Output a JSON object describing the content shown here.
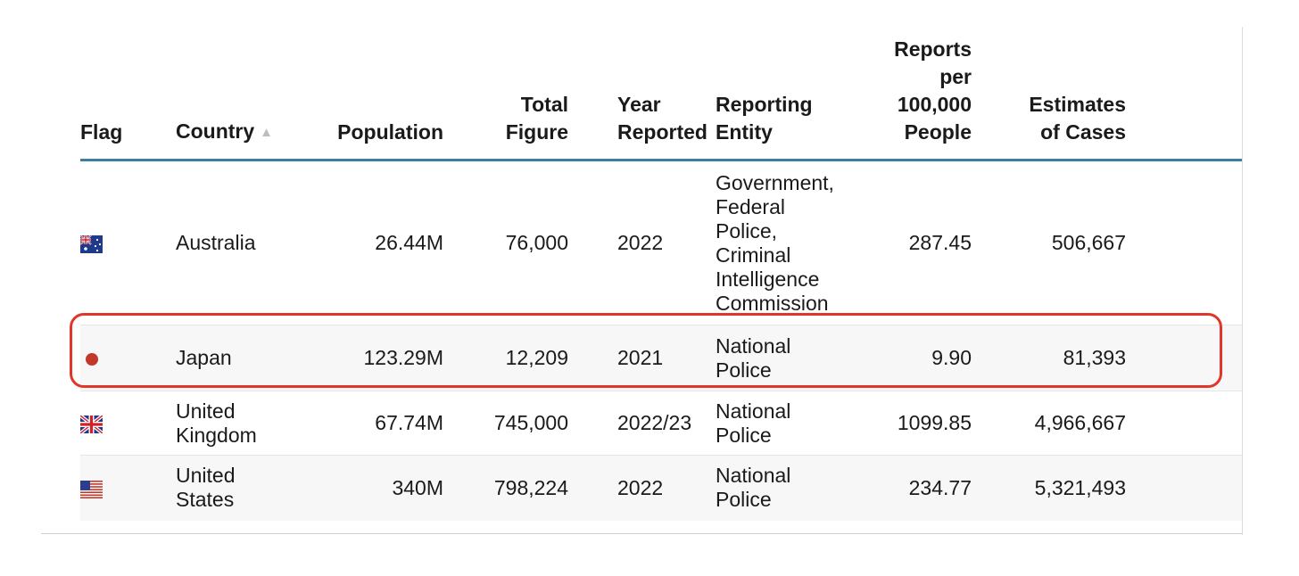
{
  "table": {
    "headers": {
      "flag": "Flag",
      "country": "Country",
      "population": "Population",
      "total": "Total Figure",
      "year": "Year Reported",
      "entity": "Reporting Entity",
      "rate": "Reports per 100,000 People",
      "estimates": "Estimates of Cases"
    },
    "sort_indicator": "▲",
    "rows": [
      {
        "flag_icon": "australia-flag-icon",
        "country": "Australia",
        "population": "26.44M",
        "total": "76,000",
        "year": "2022",
        "entity": "Government, Federal Police, Criminal Intelligence Commission",
        "rate": "287.45",
        "estimates": "506,667"
      },
      {
        "flag_icon": "japan-flag-icon",
        "country": "Japan",
        "population": "123.29M",
        "total": "12,209",
        "year": "2021",
        "entity": "National Police",
        "rate": "9.90",
        "estimates": "81,393"
      },
      {
        "flag_icon": "uk-flag-icon",
        "country": "United Kingdom",
        "population": "67.74M",
        "total": "745,000",
        "year": "2022/23",
        "entity": "National Police",
        "rate": "1099.85",
        "estimates": "4,966,667"
      },
      {
        "flag_icon": "us-flag-icon",
        "country": "United States",
        "population": "340M",
        "total": "798,224",
        "year": "2022",
        "entity": "National Police",
        "rate": "234.77",
        "estimates": "5,321,493"
      }
    ]
  },
  "colors": {
    "header_rule": "#3e7ea3",
    "highlight_border": "#e0362c",
    "japan_flag": "#c0392b"
  },
  "highlighted_row": "Japan"
}
